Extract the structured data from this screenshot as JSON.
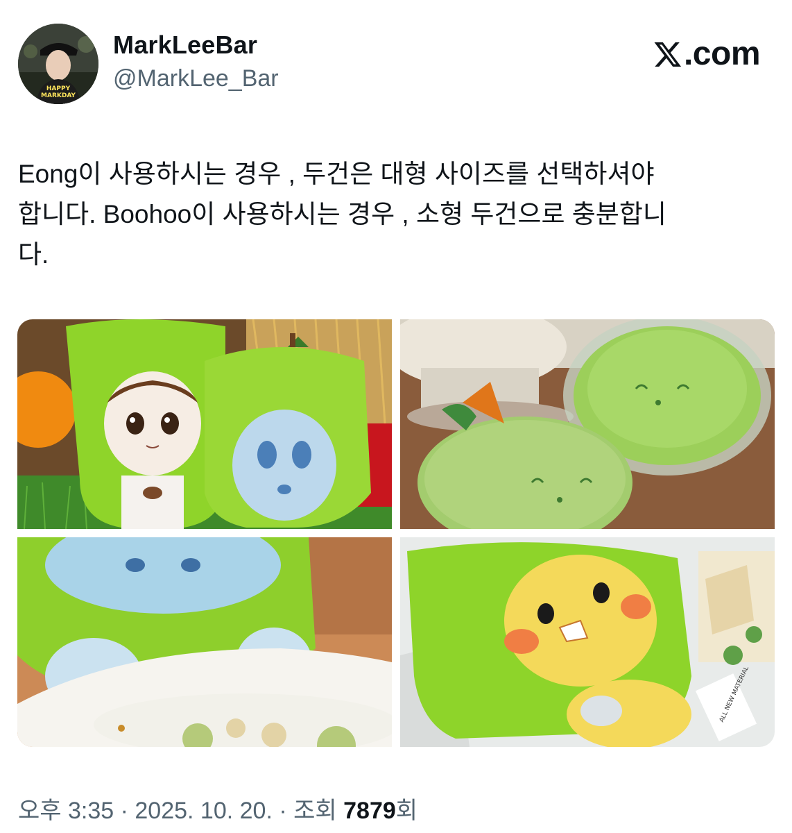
{
  "author": {
    "display_name": "MarkLeeBar",
    "handle": "@MarkLee_Bar",
    "avatar_caption_line1": "HAPPY",
    "avatar_caption_line2": "MARKDAY"
  },
  "brand": {
    "label": ".com",
    "icon": "x-logo-icon"
  },
  "tweet": {
    "text": "Eong이 사용하시는 경우 , 두건은 대형 사이즈를 선택하셔야\n합니다. Boohoo이 사용하시는 경우 , 소형 두건으로 충분합니\n다."
  },
  "media": {
    "photos": [
      {
        "name": "photo-apple-hoodie-plushies-pair"
      },
      {
        "name": "photo-apple-plush-ball-in-capsule"
      },
      {
        "name": "photo-blue-plush-in-bowl"
      },
      {
        "name": "photo-yellow-plush-apple-hood",
        "tag_text": "ALL NEW MATERIAL"
      }
    ]
  },
  "meta": {
    "time": "오후 3:35 · 2025. 10. 20. · 조회 ",
    "views_count": "7879",
    "views_suffix": "회"
  },
  "colors": {
    "text_primary": "#0f1419",
    "text_secondary": "#536471",
    "hood_green": "#8fd42a"
  }
}
